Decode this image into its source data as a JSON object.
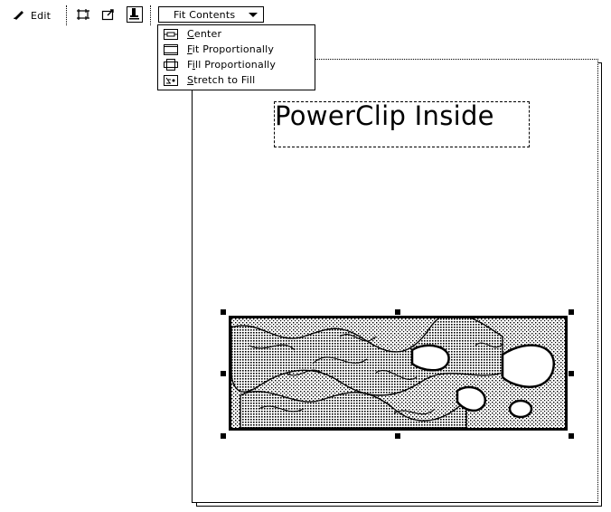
{
  "toolbar": {
    "edit_label": "Edit",
    "fit_select_value": "Fit Contents",
    "icons": [
      "pencil-icon",
      "crop-frame-icon",
      "extract-icon",
      "lock-contents-icon"
    ]
  },
  "menu": {
    "items": [
      {
        "prefix": "",
        "accel": "C",
        "rest": "enter",
        "icon": "center-icon"
      },
      {
        "prefix": "",
        "accel": "F",
        "rest": "it Proportionally",
        "icon": "fit-proportionally-icon"
      },
      {
        "prefix": "F",
        "accel": "i",
        "rest": "ll Proportionally",
        "icon": "fill-proportionally-icon"
      },
      {
        "prefix": "",
        "accel": "S",
        "rest": "tretch to Fill",
        "icon": "stretch-to-fill-icon"
      }
    ]
  },
  "canvas": {
    "text_object": "PowerClip Inside"
  },
  "colors": {
    "foreground": "#000000",
    "background": "#ffffff"
  }
}
